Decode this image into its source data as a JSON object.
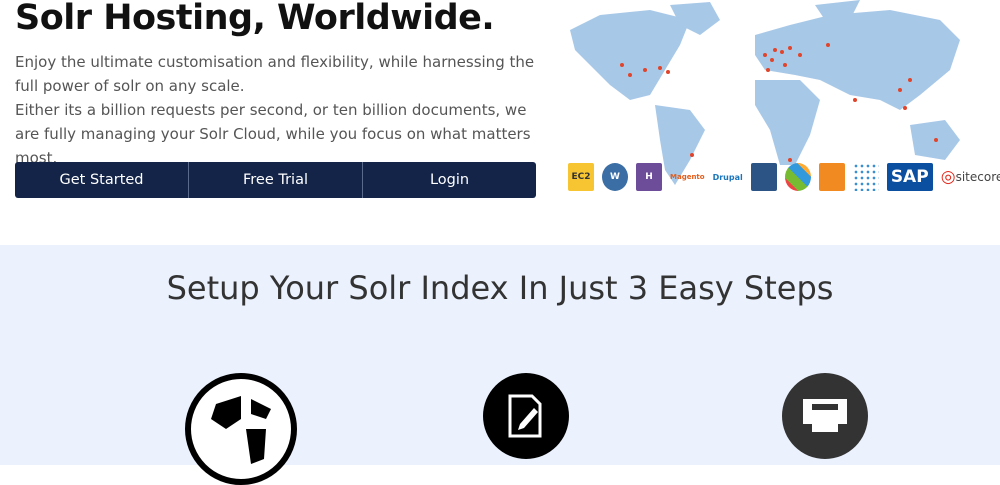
{
  "hero": {
    "title": "Solr Hosting, Worldwide.",
    "paragraph1": "Enjoy the ultimate customisation and flexibility, while harnessing the full power of solr on any scale.",
    "paragraph2": "Either its a billion requests per second, or ten billion documents, we are fully managing your Solr Cloud, while you focus on what matters most.",
    "buttons": [
      "Get Started",
      "Free Trial",
      "Login"
    ]
  },
  "logos": [
    "EC2",
    "W",
    "H",
    "Magento",
    "Drupal",
    "",
    "",
    "",
    "",
    "SAP",
    "sitecore"
  ],
  "steps": {
    "title": "Setup Your Solr Index In Just 3 Easy Steps"
  },
  "colors": {
    "button": "#132448",
    "map": "#a8c8e8",
    "dot": "#e0452b",
    "section": "#ebf2fd"
  }
}
